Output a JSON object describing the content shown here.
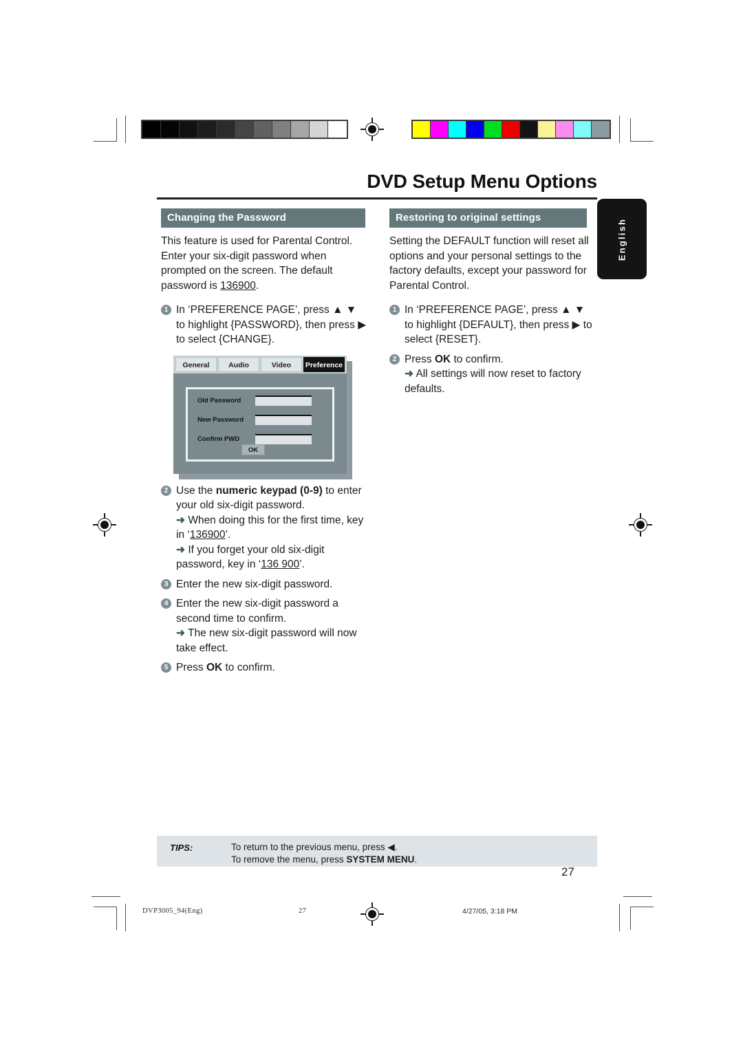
{
  "document": {
    "title": "DVD Setup Menu Options",
    "page_number": "27",
    "language_tab": "English"
  },
  "left_column": {
    "heading": "Changing the Password",
    "intro_parts": {
      "before": "This feature is used for Parental Control. Enter your six-digit password when prompted on the screen. The default password is ",
      "password": "136900",
      "after": "."
    },
    "steps": [
      {
        "num": "1",
        "text": "In ‘PREFERENCE PAGE’, press ▲ ▼ to highlight {PASSWORD}, then press ▶ to select {CHANGE}."
      },
      {
        "num": "2",
        "lead_before": "Use the ",
        "lead_bold": "numeric keypad (0-9)",
        "lead_after": " to enter your old six-digit password.",
        "notes": [
          {
            "arrow": "➜",
            "before": "When doing this for the first time, key in ‘",
            "code": "136900",
            "after": "’."
          },
          {
            "arrow": "➜",
            "before": "If you forget your old six-digit password, key in ‘",
            "code": "136 900",
            "after": "’."
          }
        ]
      },
      {
        "num": "3",
        "text": "Enter the new six-digit password."
      },
      {
        "num": "4",
        "text": "Enter the new six-digit password a second time to confirm.",
        "notes": [
          {
            "arrow": "➜",
            "before": "The new six-digit password will now take effect.",
            "code": "",
            "after": ""
          }
        ]
      },
      {
        "num": "5",
        "before": "Press ",
        "bold": "OK",
        "after": " to confirm."
      }
    ],
    "osd_screen": {
      "tabs": [
        {
          "label": "General",
          "active": false
        },
        {
          "label": "Audio",
          "active": false
        },
        {
          "label": "Video",
          "active": false
        },
        {
          "label": "Preference",
          "active": true
        }
      ],
      "fields": [
        {
          "label": "Old Password",
          "value": ""
        },
        {
          "label": "New Password",
          "value": ""
        },
        {
          "label": "Confirm PWD",
          "value": ""
        }
      ],
      "ok_button": "OK"
    }
  },
  "right_column": {
    "heading": "Restoring to original settings",
    "intro": "Setting the DEFAULT function will reset all options and your personal settings to the factory defaults, except your password for Parental Control.",
    "steps": [
      {
        "num": "1",
        "text": "In ‘PREFERENCE PAGE’, press ▲ ▼ to highlight {DEFAULT}, then press ▶ to select {RESET}."
      },
      {
        "num": "2",
        "before": "Press ",
        "bold": "OK",
        "after": " to confirm.",
        "notes": [
          {
            "arrow": "➜",
            "text": "All settings will now reset to factory defaults."
          }
        ]
      }
    ]
  },
  "tips": {
    "label": "TIPS:",
    "line1": "To return to the previous menu, press ◀.",
    "line2_before": "To remove the menu, press ",
    "line2_bold": "SYSTEM MENU",
    "line2_after": "."
  },
  "print_footer": {
    "file_name": "DVP3005_94(Eng)",
    "page": "27",
    "timestamp": "4/27/05, 3:18 PM"
  },
  "calibration": {
    "gray_patches": [
      "#000000",
      "#050505",
      "#111111",
      "#1d1d1d",
      "#2b2b2b",
      "#454545",
      "#616161",
      "#808080",
      "#a6a6a6",
      "#d5d5d5",
      "#ffffff"
    ],
    "color_patches": [
      "#ffff00",
      "#ff00ff",
      "#00ffff",
      "#0000ee",
      "#00dd22",
      "#ee0000",
      "#141414",
      "#fbf396",
      "#fb8cf0",
      "#7ffbfb",
      "#8b9ba0"
    ]
  },
  "colors": {
    "section_bar": "#64787c",
    "step_bullet": "#7d8f94",
    "tips_bg": "#dde3e6",
    "osd_bg": "#7b8a8e",
    "lang_tab_bg": "#141414"
  }
}
